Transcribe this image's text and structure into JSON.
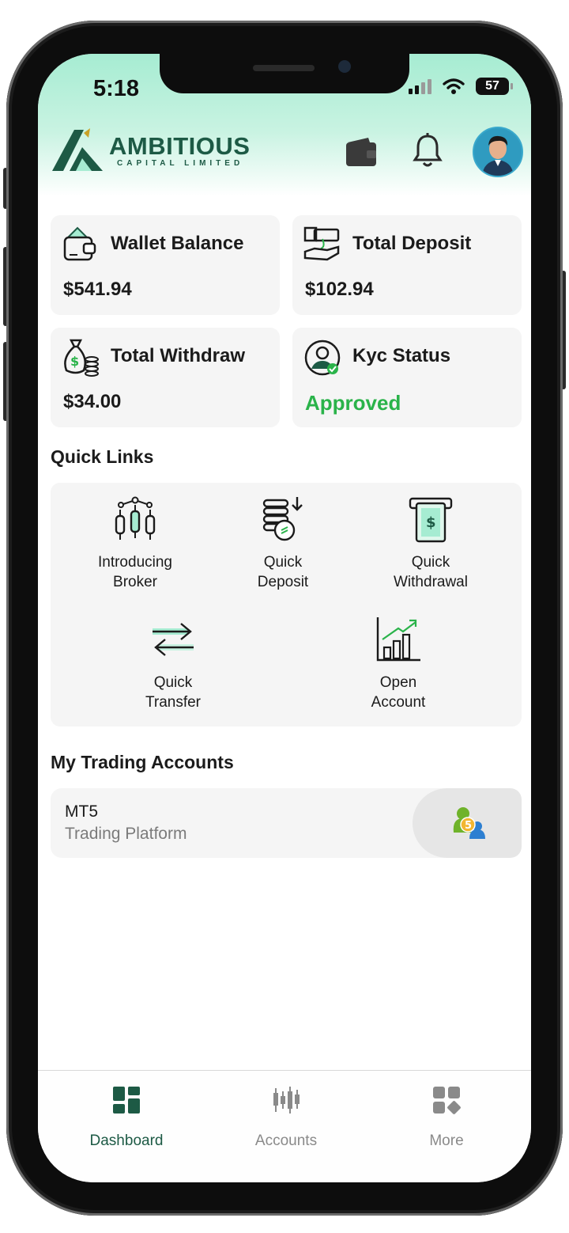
{
  "status_bar": {
    "time": "5:18",
    "battery": "57"
  },
  "brand": {
    "name": "AMBITIOUS",
    "tagline": "CAPITAL LIMITED"
  },
  "header": {
    "wallet_icon": "wallet-icon",
    "bell_icon": "bell-icon",
    "avatar": "user-avatar"
  },
  "cards": [
    {
      "label": "Wallet Balance",
      "value": "$541.94",
      "icon": "wallet-balance-icon"
    },
    {
      "label": "Total Deposit",
      "value": "$102.94",
      "icon": "deposit-hand-icon"
    },
    {
      "label": "Total Withdraw",
      "value": "$34.00",
      "icon": "money-bag-icon"
    },
    {
      "label": "Kyc Status",
      "value": "Approved",
      "icon": "kyc-user-check-icon"
    }
  ],
  "quick_links": {
    "title": "Quick Links",
    "items": [
      {
        "label": "Introducing\nBroker",
        "icon": "candlestick-network-icon"
      },
      {
        "label": "Quick\nDeposit",
        "icon": "coin-stack-deposit-icon"
      },
      {
        "label": "Quick\nWithdrawal",
        "icon": "atm-withdraw-icon"
      },
      {
        "label": "Quick\nTransfer",
        "icon": "transfer-arrows-icon"
      },
      {
        "label": "Open\nAccount",
        "icon": "growth-chart-icon"
      }
    ]
  },
  "trading_accounts": {
    "title": "My Trading Accounts",
    "items": [
      {
        "name": "MT5",
        "subtitle": "Trading Platform",
        "icon": "mt5-logo-icon"
      }
    ]
  },
  "tabbar": {
    "items": [
      {
        "label": "Dashboard",
        "icon": "dashboard-grid-icon",
        "active": true
      },
      {
        "label": "Accounts",
        "icon": "candlestick-icon",
        "active": false
      },
      {
        "label": "More",
        "icon": "more-apps-icon",
        "active": false
      }
    ]
  },
  "colors": {
    "brand_green": "#1d5a45",
    "approved_green": "#2ab34a",
    "header_mint": "#a6ecd2"
  }
}
